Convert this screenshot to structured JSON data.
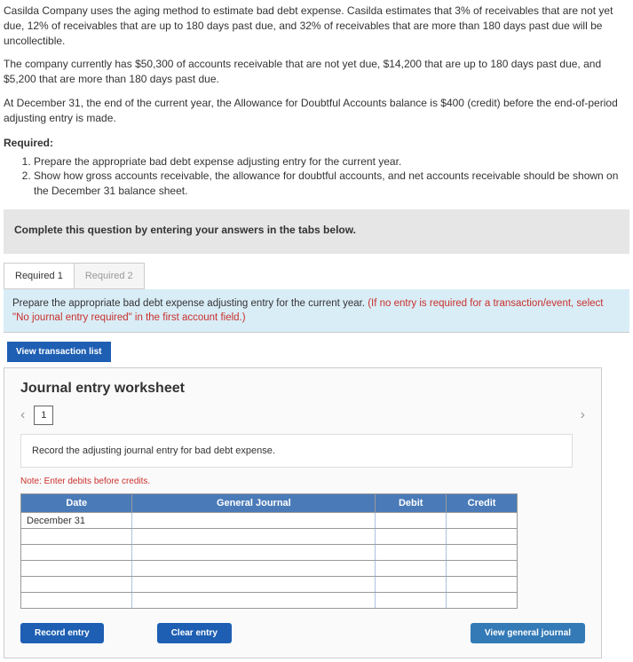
{
  "problem": {
    "p1": "Casilda Company uses the aging method to estimate bad debt expense. Casilda estimates that 3% of receivables that are not yet due, 12% of receivables that are up to 180 days past due, and 32% of receivables that are more than 180 days past due will be uncollectible.",
    "p2": "The company currently has $50,300 of accounts receivable that are not yet due, $14,200 that are up to 180 days past due, and $5,200 that are more than 180 days past due.",
    "p3": "At December 31, the end of the current year, the Allowance for Doubtful Accounts balance is $400 (credit) before the end-of-period adjusting entry is made."
  },
  "required": {
    "heading": "Required:",
    "items": [
      "Prepare the appropriate bad debt expense adjusting entry for the current year.",
      "Show how gross accounts receivable, the allowance for doubtful accounts, and net accounts receivable should be shown on the December 31 balance sheet."
    ]
  },
  "instructionBar": "Complete this question by entering your answers in the tabs below.",
  "tabs": {
    "tab1": "Required 1",
    "tab2": "Required 2"
  },
  "highlight": {
    "black": "Prepare the appropriate bad debt expense adjusting entry for the current year. ",
    "red": "(If no entry is required for a transaction/event, select \"No journal entry required\" in the first account field.)"
  },
  "buttons": {
    "viewTransaction": "View transaction list",
    "recordEntry": "Record entry",
    "clearEntry": "Clear entry",
    "viewGeneral": "View general journal"
  },
  "worksheet": {
    "title": "Journal entry worksheet",
    "pageNum": "1",
    "recordPrompt": "Record the adjusting journal entry for bad debt expense.",
    "note": "Note: Enter debits before credits.",
    "headers": {
      "date": "Date",
      "gj": "General Journal",
      "debit": "Debit",
      "credit": "Credit"
    },
    "row1date": "December 31"
  }
}
